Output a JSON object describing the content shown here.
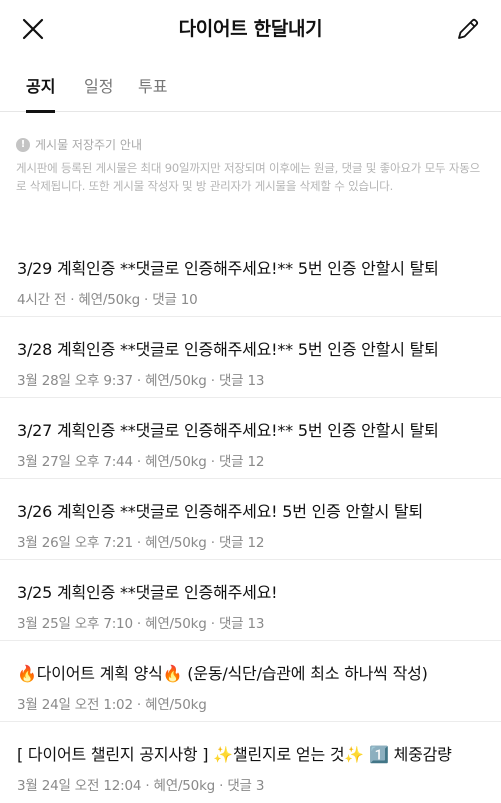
{
  "header": {
    "title": "다이어트 한달내기",
    "close_icon": "close-icon",
    "edit_icon": "pencil-icon"
  },
  "tabs": [
    {
      "label": "공지",
      "active": true
    },
    {
      "label": "일정",
      "active": false
    },
    {
      "label": "투표",
      "active": false
    }
  ],
  "notice": {
    "heading": "게시물 저장주기 안내",
    "body": "게시판에 등록된 게시물은 최대 90일까지만 저장되며 이후에는 원글, 댓글 및 좋아요가 모두 자동으로 삭제됩니다. 또한 게시물 작성자 및 방 관리자가 게시물을 삭제할 수 있습니다."
  },
  "posts": [
    {
      "title": "3/29 계획인증 **댓글로 인증해주세요!** 5번 인증 안할시 탈퇴",
      "meta": "4시간 전 · 혜연/50kg · 댓글 10"
    },
    {
      "title": "3/28 계획인증 **댓글로 인증해주세요!** 5번 인증 안할시 탈퇴",
      "meta": "3월 28일 오후 9:37 · 혜연/50kg · 댓글 13"
    },
    {
      "title": "3/27 계획인증 **댓글로 인증해주세요!** 5번 인증 안할시 탈퇴",
      "meta": "3월 27일 오후 7:44 · 혜연/50kg · 댓글 12"
    },
    {
      "title": "3/26 계획인증 **댓글로 인증해주세요! 5번 인증 안할시 탈퇴",
      "meta": "3월 26일 오후 7:21 · 혜연/50kg · 댓글 12"
    },
    {
      "title": "3/25 계획인증 **댓글로 인증해주세요!",
      "meta": "3월 25일 오후 7:10 · 혜연/50kg · 댓글 13"
    },
    {
      "title": "🔥다이어트 계획 양식🔥 (운동/식단/습관에 최소 하나씩 작성)",
      "meta": "3월 24일 오전 1:02 · 혜연/50kg"
    },
    {
      "title": "[ 다이어트 챌린지 공지사항 ] ✨챌린지로 얻는 것✨ 1️⃣ 체중감량",
      "meta": "3월 24일 오전 12:04 · 혜연/50kg · 댓글 3"
    }
  ],
  "colors": {
    "text": "#111111",
    "muted": "#8a8a8a",
    "notice": "#b4b4b4",
    "divider": "#ececec"
  }
}
